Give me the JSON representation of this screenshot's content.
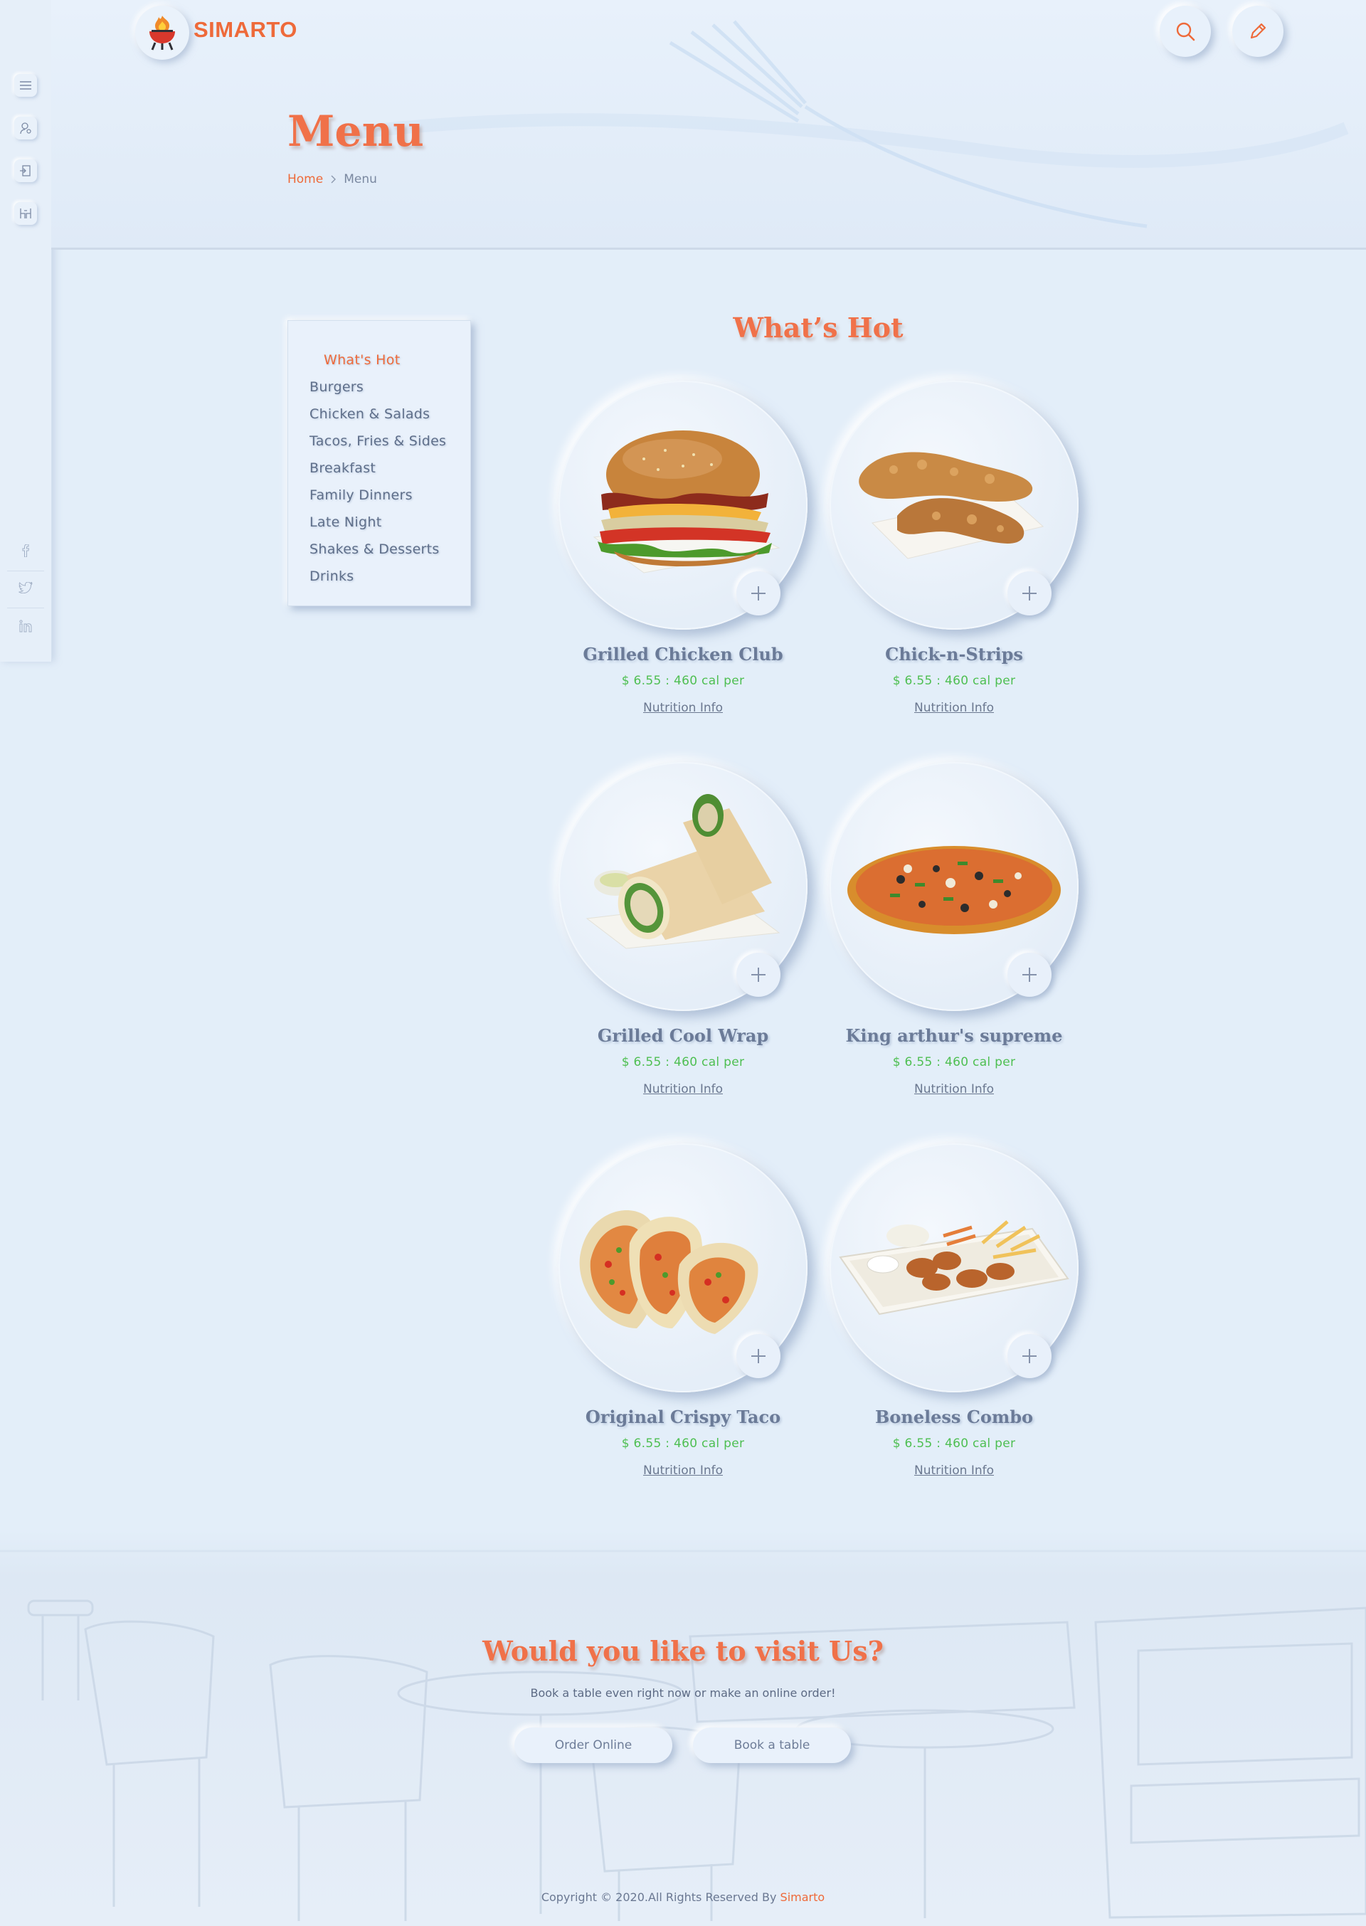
{
  "brand": {
    "name": "SIMARTO"
  },
  "header": {
    "search_icon": "search-icon",
    "edit_icon": "pencil-icon",
    "title": "Menu",
    "breadcrumb": {
      "home": "Home",
      "current": "Menu"
    }
  },
  "sidebar_icons": [
    "menu-icon",
    "user-icon",
    "login-icon",
    "reservation-icon"
  ],
  "social": [
    "facebook-icon",
    "twitter-icon",
    "linkedin-icon"
  ],
  "categories": [
    {
      "label": "What's Hot",
      "active": true
    },
    {
      "label": "Burgers"
    },
    {
      "label": "Chicken & Salads"
    },
    {
      "label": "Tacos, Fries & Sides"
    },
    {
      "label": "Breakfast"
    },
    {
      "label": "Family Dinners"
    },
    {
      "label": "Late Night"
    },
    {
      "label": "Shakes & Desserts"
    },
    {
      "label": "Drinks"
    }
  ],
  "section": {
    "title": "What’s Hot"
  },
  "items": [
    {
      "name": "Grilled Chicken Club",
      "price": "$ 6.55 : 460 cal per",
      "link": "Nutrition Info",
      "image": "burger"
    },
    {
      "name": "Chick-n-Strips",
      "price": "$ 6.55 : 460 cal per",
      "link": "Nutrition Info",
      "image": "chicken-strips"
    },
    {
      "name": "Grilled Cool Wrap",
      "price": "$ 6.55 : 460 cal per",
      "link": "Nutrition Info",
      "image": "wrap"
    },
    {
      "name": "King arthur's supreme",
      "price": "$ 6.55 : 460 cal per",
      "link": "Nutrition Info",
      "image": "pizza"
    },
    {
      "name": "Original Crispy Taco",
      "price": "$ 6.55 : 460 cal per",
      "link": "Nutrition Info",
      "image": "tacos"
    },
    {
      "name": "Boneless Combo",
      "price": "$ 6.55 : 460 cal per",
      "link": "Nutrition Info",
      "image": "wings-combo"
    }
  ],
  "visit": {
    "title": "Would you like to visit Us?",
    "subtitle": "Book a table even right now or make an online order!",
    "order_label": "Order Online",
    "book_label": "Book a table"
  },
  "footer": {
    "copyright": "Copyright © 2020.All Rights Reserved By",
    "brand": "Simarto"
  },
  "colors": {
    "accent": "#ee6a3a",
    "price": "#4ebf52",
    "background": "#e3eef9"
  }
}
